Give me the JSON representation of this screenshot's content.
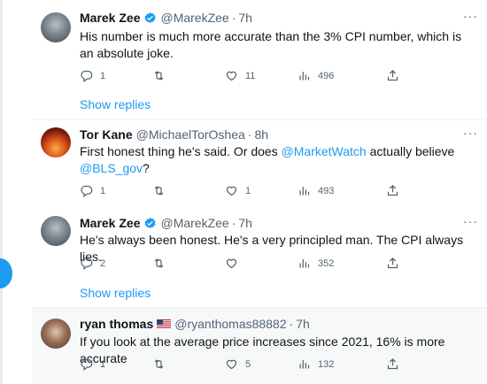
{
  "tweets": [
    {
      "name": "Marek Zee",
      "handle": "@MarekZee",
      "time": "7h",
      "text": "His number is much more accurate than the 3% CPI number, which is an absolute joke.",
      "reply_count": "1",
      "retweet_count": "",
      "like_count": "11",
      "view_count": "496",
      "show_replies": "Show replies"
    },
    {
      "name": "Tor Kane",
      "handle": "@MichaelTorOshea",
      "time": "8h",
      "text_before": "First honest thing he's said. Or does ",
      "mention1": "@MarketWatch",
      "text_middle": " actually believe",
      "mention2": "@BLS_gov",
      "text_after": "?",
      "reply_count": "1",
      "retweet_count": "",
      "like_count": "1",
      "view_count": "493"
    },
    {
      "name": "Marek Zee",
      "handle": "@MarekZee",
      "time": "7h",
      "text": "He's always been honest. He's a very principled man. The CPI always lies.",
      "reply_count": "2",
      "retweet_count": "",
      "like_count": "",
      "view_count": "352",
      "show_replies": "Show replies"
    },
    {
      "name": "ryan thomas",
      "handle": "@ryanthomas88882",
      "time": "7h",
      "text": "If you look at the average price increases since 2021, 16% is more accurate",
      "reply_count": "1",
      "retweet_count": "",
      "like_count": "5",
      "view_count": "132"
    }
  ],
  "ui": {
    "separator": "·",
    "more_label": "···"
  },
  "colors": {
    "accent": "#1d9bf0",
    "secondary_text": "#536471",
    "primary_text": "#0f1419"
  },
  "icons": [
    "verified-badge-icon",
    "reply-icon",
    "retweet-icon",
    "like-icon",
    "views-icon",
    "share-icon",
    "more-icon",
    "us-flag-icon"
  ]
}
